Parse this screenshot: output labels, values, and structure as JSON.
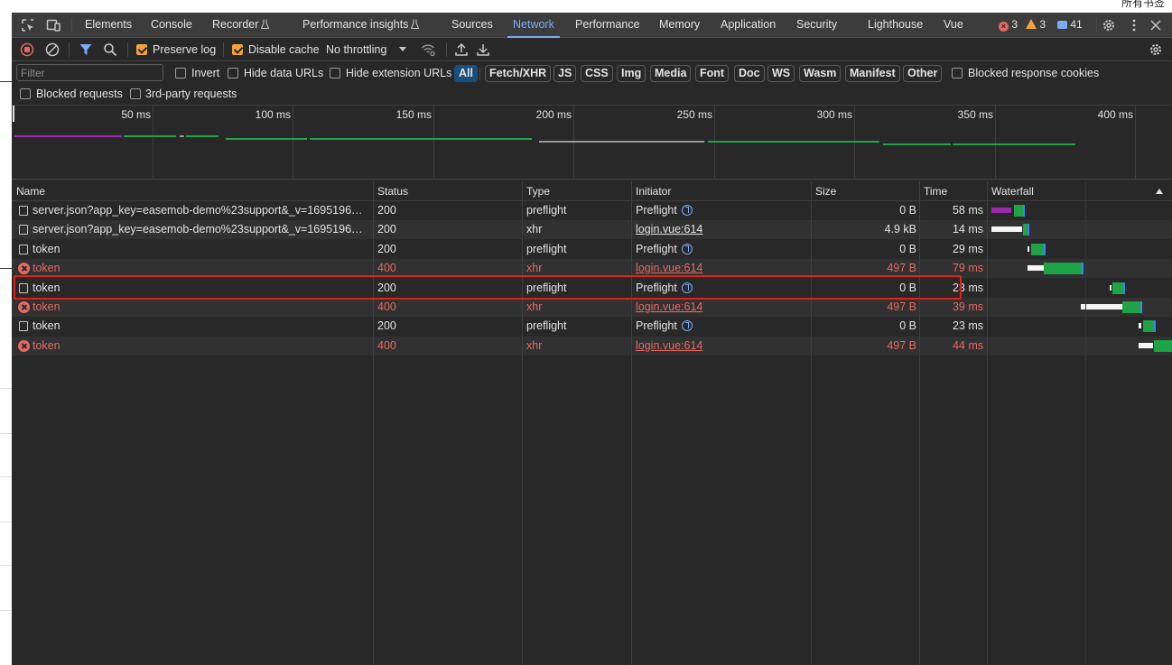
{
  "page_corner_text": "所有书签",
  "tabs": [
    "Elements",
    "Console",
    "Recorder",
    "Performance insights",
    "Sources",
    "Network",
    "Performance",
    "Memory",
    "Application",
    "Security",
    "Lighthouse",
    "Vue"
  ],
  "active_tab": "Network",
  "issue_counts": {
    "errors": "3",
    "warnings": "3",
    "messages": "41"
  },
  "network_toolbar": {
    "preserve_log": "Preserve log",
    "disable_cache": "Disable cache",
    "throttling": "No throttling"
  },
  "filter": {
    "placeholder": "Filter",
    "invert": "Invert",
    "hide_data_urls": "Hide data URLs",
    "hide_extension_urls": "Hide extension URLs",
    "types": [
      "All",
      "Fetch/XHR",
      "JS",
      "CSS",
      "Img",
      "Media",
      "Font",
      "Doc",
      "WS",
      "Wasm",
      "Manifest",
      "Other"
    ],
    "active_type": "All",
    "blocked_response_cookies": "Blocked response cookies",
    "blocked_requests": "Blocked requests",
    "third_party": "3rd-party requests"
  },
  "overview_ticks": [
    "50 ms",
    "100 ms",
    "150 ms",
    "200 ms",
    "250 ms",
    "300 ms",
    "350 ms",
    "400 ms"
  ],
  "columns": {
    "name": "Name",
    "status": "Status",
    "type": "Type",
    "initiator": "Initiator",
    "size": "Size",
    "time": "Time",
    "waterfall": "Waterfall"
  },
  "requests": [
    {
      "name": "server.json?app_key=easemob-demo%23support&_v=169519610...",
      "status": "200",
      "type": "preflight",
      "initiator": "Preflight",
      "size": "0 B",
      "time": "58 ms",
      "error": false
    },
    {
      "name": "server.json?app_key=easemob-demo%23support&_v=169519610...",
      "status": "200",
      "type": "xhr",
      "initiator": "login.vue:614",
      "size": "4.9 kB",
      "time": "14 ms",
      "error": false
    },
    {
      "name": "token",
      "status": "200",
      "type": "preflight",
      "initiator": "Preflight",
      "size": "0 B",
      "time": "29 ms",
      "error": false
    },
    {
      "name": "token",
      "status": "400",
      "type": "xhr",
      "initiator": "login.vue:614",
      "size": "497 B",
      "time": "79 ms",
      "error": true
    },
    {
      "name": "token",
      "status": "200",
      "type": "preflight",
      "initiator": "Preflight",
      "size": "0 B",
      "time": "23 ms",
      "error": false
    },
    {
      "name": "token",
      "status": "400",
      "type": "xhr",
      "initiator": "login.vue:614",
      "size": "497 B",
      "time": "39 ms",
      "error": true
    },
    {
      "name": "token",
      "status": "200",
      "type": "preflight",
      "initiator": "Preflight",
      "size": "0 B",
      "time": "23 ms",
      "error": false
    },
    {
      "name": "token",
      "status": "400",
      "type": "xhr",
      "initiator": "login.vue:614",
      "size": "497 B",
      "time": "44 ms",
      "error": true
    }
  ],
  "colors": {
    "accent": "#7cacf8",
    "error": "#e46962",
    "warning": "#f2a33c",
    "waterfall_green": "#1ea446",
    "waterfall_purple": "#9c27b0",
    "highlight": "#e0201a"
  }
}
